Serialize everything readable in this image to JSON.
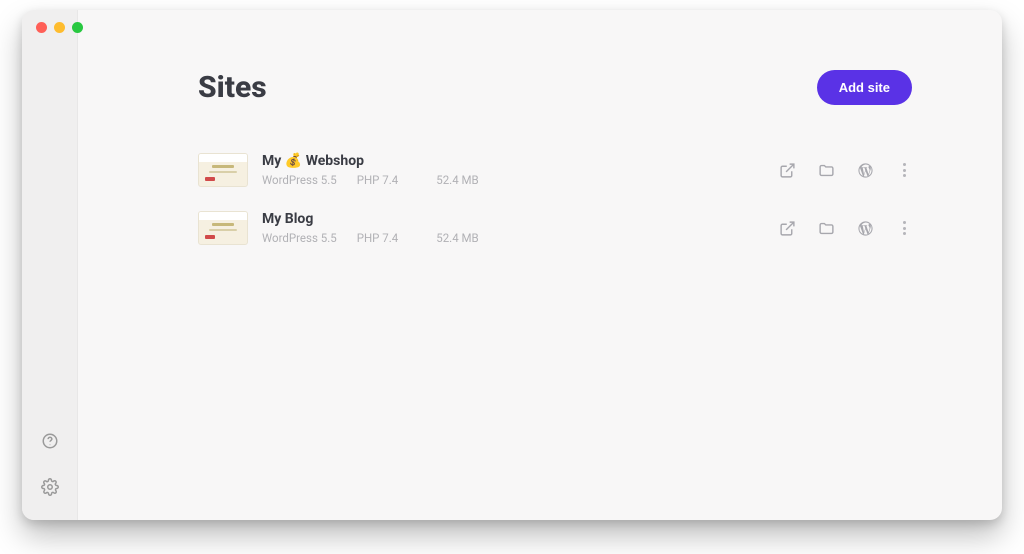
{
  "page_title": "Sites",
  "add_site_label": "Add site",
  "sites": [
    {
      "name": "My 💰 Webshop",
      "wp": "WordPress 5.5",
      "php": "PHP 7.4",
      "size": "52.4 MB"
    },
    {
      "name": "My Blog",
      "wp": "WordPress 5.5",
      "php": "PHP 7.4",
      "size": "52.4 MB"
    }
  ]
}
